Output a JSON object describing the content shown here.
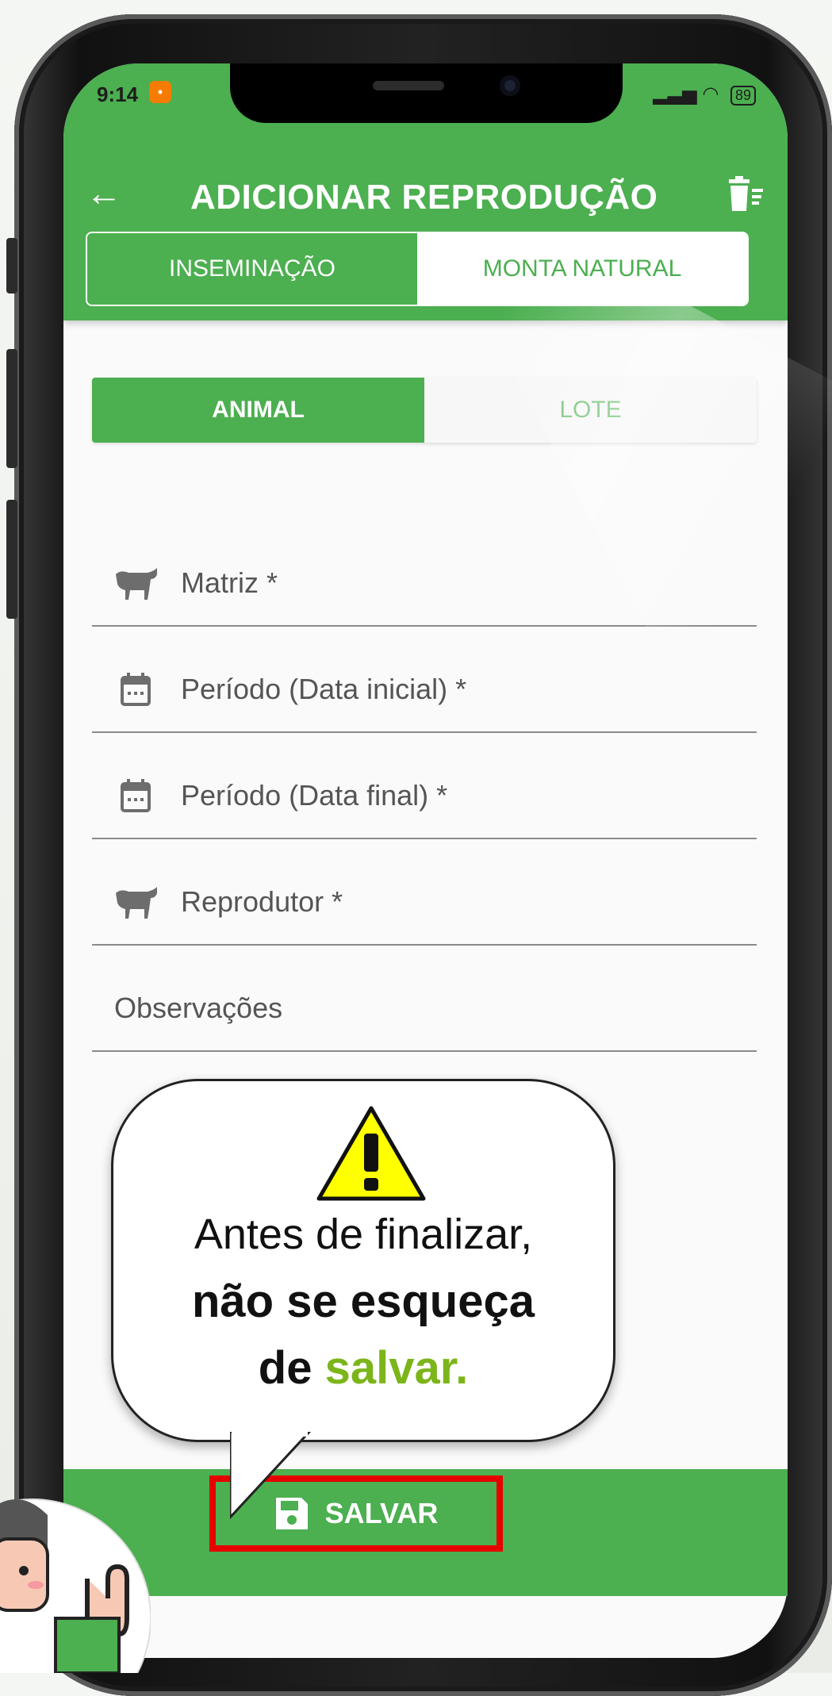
{
  "status_bar": {
    "time": "9:14",
    "battery": "89"
  },
  "header": {
    "title": "ADICIONAR REPRODUÇÃO"
  },
  "method_tabs": {
    "left": "INSEMINAÇÃO",
    "right": "MONTA NATURAL",
    "selected": "MONTA NATURAL"
  },
  "target_tabs": {
    "left": "ANIMAL",
    "right": "LOTE",
    "selected": "ANIMAL"
  },
  "fields": [
    {
      "label": "Matriz *",
      "icon": "cow-icon"
    },
    {
      "label": "Período (Data inicial) *",
      "icon": "calendar-icon"
    },
    {
      "label": "Período (Data final) *",
      "icon": "calendar-icon"
    },
    {
      "label": "Reprodutor *",
      "icon": "cow-icon"
    },
    {
      "label": "Observações",
      "icon": ""
    }
  ],
  "tip": {
    "line1": "Antes de finalizar,",
    "line2": "não se esqueça",
    "line3_prefix": "de ",
    "line3_accent": "salvar."
  },
  "save_button": {
    "label": "SALVAR"
  },
  "colors": {
    "primary": "#4caf50",
    "accent": "#7cb51a",
    "highlight": "#e60000"
  }
}
